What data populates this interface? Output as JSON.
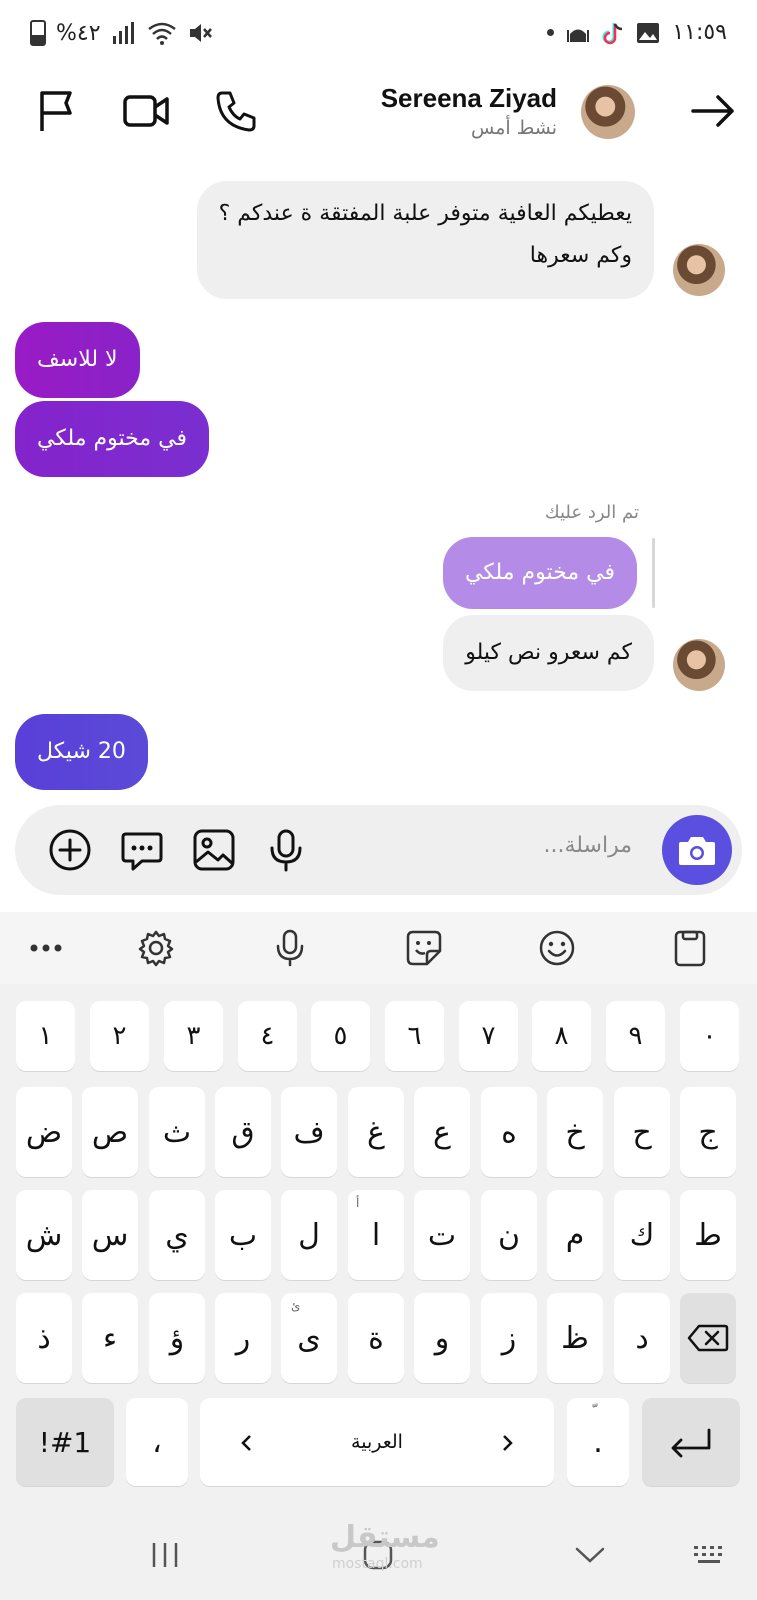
{
  "status_bar": {
    "time": "١١:٥٩",
    "battery": "%٤٢",
    "icons": [
      "gallery-icon",
      "tiktok-icon",
      "mosque-icon",
      "dot-icon",
      "mute-icon",
      "wifi-icon",
      "signal-icon",
      "battery-icon"
    ]
  },
  "header": {
    "name": "Sereena Ziyad",
    "status": "نشط أمس",
    "icons": [
      "back-arrow-icon",
      "phone-icon",
      "video-icon",
      "flag-icon"
    ]
  },
  "messages": [
    {
      "dir": "in",
      "lines": [
        "يعطيكم العافية متوفر علبة المفتقة ة عندكم ؟",
        "وكم سعرها"
      ]
    },
    {
      "dir": "out",
      "text": "لا للاسف"
    },
    {
      "dir": "out",
      "text": "في مختوم ملكي"
    },
    {
      "dir": "reply",
      "label": "تم الرد عليك",
      "quoted": "في مختوم ملكي"
    },
    {
      "dir": "in",
      "text": "كم سعرو نص كيلو"
    },
    {
      "dir": "out",
      "text": "20 شيكل"
    }
  ],
  "composer": {
    "placeholder": "مراسلة...",
    "icons": [
      "add-icon",
      "chat-bubble-icon",
      "image-icon",
      "mic-icon",
      "camera-icon"
    ]
  },
  "keyboard": {
    "toolbar_icons": [
      "more-icon",
      "settings-icon",
      "mic-icon",
      "sticker-icon",
      "emoji-icon",
      "clipboard-icon"
    ],
    "number_row": [
      "١",
      "٢",
      "٣",
      "٤",
      "٥",
      "٦",
      "٧",
      "٨",
      "٩",
      "٠"
    ],
    "row1": [
      "ض",
      "ص",
      "ث",
      "ق",
      "ف",
      "غ",
      "ع",
      "ه",
      "خ",
      "ح",
      "ج"
    ],
    "row2": [
      "ش",
      "س",
      "ي",
      "ب",
      "ل",
      "ا",
      "ت",
      "ن",
      "م",
      "ك",
      "ط"
    ],
    "row2_hint": "أ",
    "row3": [
      "ذ",
      "ء",
      "ؤ",
      "ر",
      "ى",
      "ة",
      "و",
      "ز",
      "ظ",
      "د"
    ],
    "row3_hint": "ئ",
    "symbols": "!#1",
    "comma": "،",
    "space": "العربية",
    "period": ".",
    "period_hint": "ّ"
  },
  "watermark": {
    "main": "مستقل",
    "sub": "mostaql.com"
  }
}
